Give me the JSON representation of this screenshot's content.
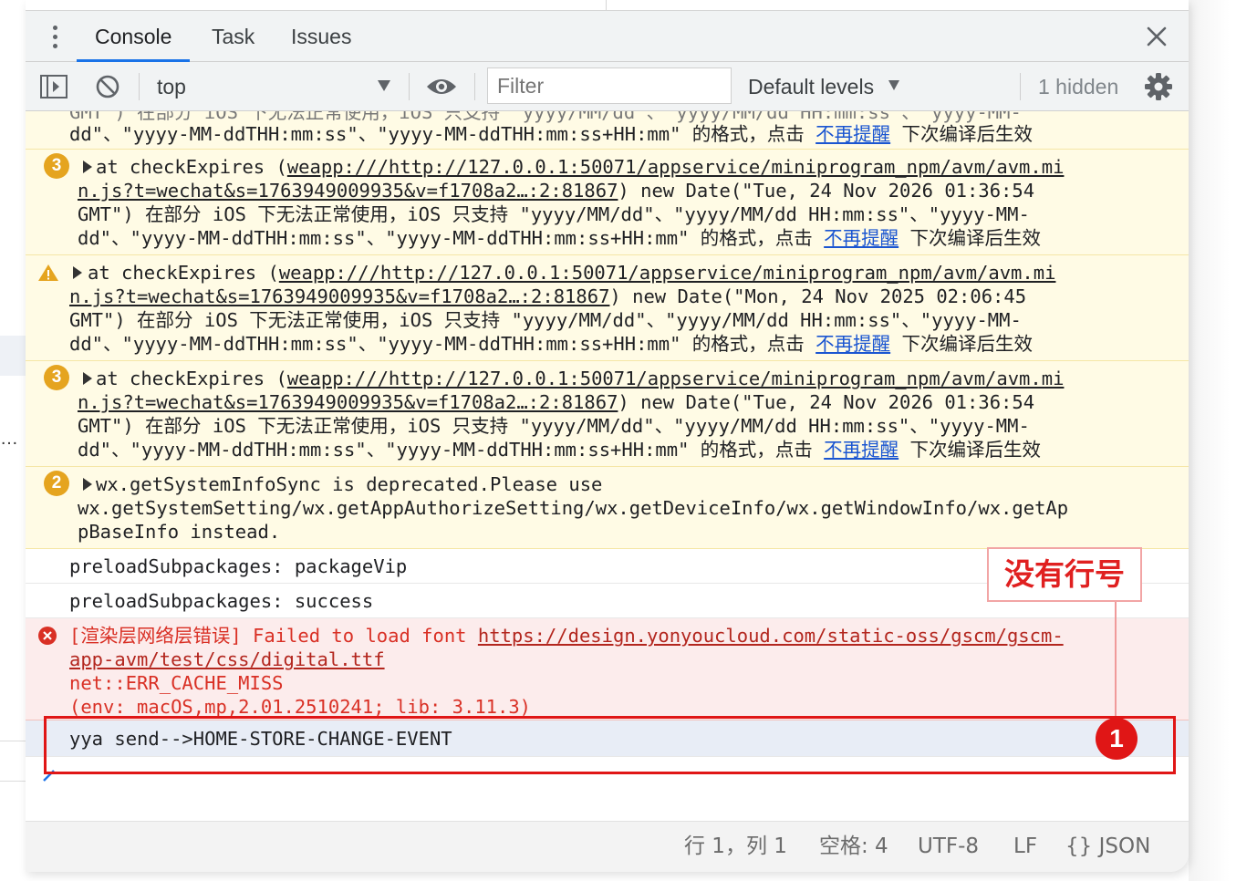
{
  "tabs": {
    "console": "Console",
    "task": "Task",
    "issues": "Issues"
  },
  "toolbar": {
    "context": "top",
    "filter_placeholder": "Filter",
    "levels": "Default levels",
    "hidden": "1 hidden"
  },
  "messages": {
    "m0": {
      "line1": "dd\"、\"yyyy-MM-ddTHH:mm:ss\"、\"yyyy-MM-ddTHH:mm:ss+HH:mm\" 的格式，点击 ",
      "link": "不再提醒",
      "tail": " 下次编译后生效"
    },
    "m1": {
      "count": "3",
      "prefix": "at checkExpires (",
      "url1": "weapp:///http://127.0.0.1:50071/appservice/miniprogram_npm/avm/avm.mi",
      "url2": "n.js?t=wechat&s=1763949009935&v=f1708a2…:2:81867",
      "after": ") new Date(\"Tue, 24 Nov 2026 01:36:54",
      "line3": "GMT\") 在部分 iOS 下无法正常使用，iOS 只支持 \"yyyy/MM/dd\"、\"yyyy/MM/dd HH:mm:ss\"、\"yyyy-MM-",
      "line4": "dd\"、\"yyyy-MM-ddTHH:mm:ss\"、\"yyyy-MM-ddTHH:mm:ss+HH:mm\" 的格式，点击 ",
      "link": "不再提醒",
      "tail": " 下次编译后生效"
    },
    "m2": {
      "prefix": "at checkExpires (",
      "url1": "weapp:///http://127.0.0.1:50071/appservice/miniprogram_npm/avm/avm.mi",
      "url2": "n.js?t=wechat&s=1763949009935&v=f1708a2…:2:81867",
      "after": ") new Date(\"Mon, 24 Nov 2025 02:06:45",
      "line3": "GMT\") 在部分 iOS 下无法正常使用，iOS 只支持 \"yyyy/MM/dd\"、\"yyyy/MM/dd HH:mm:ss\"、\"yyyy-MM-",
      "line4": "dd\"、\"yyyy-MM-ddTHH:mm:ss\"、\"yyyy-MM-ddTHH:mm:ss+HH:mm\" 的格式，点击 ",
      "link": "不再提醒",
      "tail": " 下次编译后生效"
    },
    "m3": {
      "count": "3",
      "prefix": "at checkExpires (",
      "url1": "weapp:///http://127.0.0.1:50071/appservice/miniprogram_npm/avm/avm.mi",
      "url2": "n.js?t=wechat&s=1763949009935&v=f1708a2…:2:81867",
      "after": ") new Date(\"Tue, 24 Nov 2026 01:36:54",
      "line3": "GMT\") 在部分 iOS 下无法正常使用，iOS 只支持 \"yyyy/MM/dd\"、\"yyyy/MM/dd HH:mm:ss\"、\"yyyy-MM-",
      "line4": "dd\"、\"yyyy-MM-ddTHH:mm:ss\"、\"yyyy-MM-ddTHH:mm:ss+HH:mm\" 的格式，点击 ",
      "link": "不再提醒",
      "tail": " 下次编译后生效"
    },
    "m4": {
      "count": "2",
      "line1": "wx.getSystemInfoSync is deprecated.Please use",
      "line2": "wx.getSystemSetting/wx.getAppAuthorizeSetting/wx.getDeviceInfo/wx.getWindowInfo/wx.getAp",
      "line3": "pBaseInfo instead."
    },
    "m5": {
      "text": "preloadSubpackages: packageVip"
    },
    "m6": {
      "text": "preloadSubpackages: success"
    },
    "m7": {
      "prefix": "[渲染层网络层错误] Failed to load font ",
      "url1": "https://design.yonyoucloud.com/static-oss/gscm/gscm-",
      "url2": "app-avm/test/css/digital.ttf",
      "line3": "net::ERR_CACHE_MISS",
      "line4": "(env: macOS,mp,2.01.2510241; lib: 3.11.3)"
    },
    "m8": {
      "text": "yya send-->HOME-STORE-CHANGE-EVENT"
    }
  },
  "annotation": {
    "label": "没有行号",
    "marker": "1"
  },
  "statusbar": {
    "position": "行 1，列 1",
    "spaces": "空格: 4",
    "encoding": "UTF-8",
    "eol": "LF",
    "language": "{} JSON"
  },
  "colors": {
    "accent": "#1a73e8",
    "warning_bg": "#fffbe5",
    "error_bg": "#fcecec",
    "error_text": "#d93025",
    "badge": "#e5a41f",
    "annotation_red": "#e01616"
  }
}
